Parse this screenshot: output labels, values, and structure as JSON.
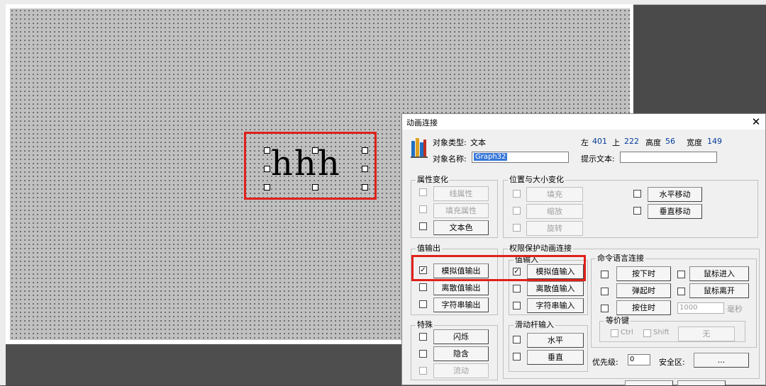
{
  "canvas": {
    "text_object": "hhh"
  },
  "dialog": {
    "title": "动画连接",
    "close": "✕",
    "object_type_label": "对象类型:",
    "object_type": "文本",
    "object_name_label": "对象名称:",
    "object_name": "Graph32",
    "left_label": "左",
    "left": "401",
    "top_label": "上",
    "top": "222",
    "height_label": "高度",
    "height": "56",
    "width_label": "宽度",
    "width": "149",
    "hint_label": "提示文本:",
    "hint": "",
    "attr_change": {
      "title": "属性变化",
      "line": "线属性",
      "fill": "填充属性",
      "text_color": "文本色"
    },
    "pos_size": {
      "title": "位置与大小变化",
      "fill": "填充",
      "scale": "缩放",
      "rotate": "旋转",
      "h_move": "水平移动",
      "v_move": "垂直移动"
    },
    "value_output": {
      "title": "值输出",
      "analog": "模拟值输出",
      "discrete": "离散值输出",
      "string": "字符串输出",
      "analog_checked": "✓"
    },
    "perm": {
      "title": "权限保护动画连接"
    },
    "value_input": {
      "title": "值输入",
      "analog": "模拟值输入",
      "discrete": "离散值输入",
      "string": "字符串输入",
      "analog_checked": "✓"
    },
    "command": {
      "title": "命令语言连接",
      "press": "按下时",
      "release": "弹起时",
      "hold": "按住时",
      "hold_ms": "1000",
      "ms": "毫秒",
      "mouse_enter": "鼠标进入",
      "mouse_leave": "鼠标离开"
    },
    "hotkey": {
      "title": "等价键",
      "ctrl": "Ctrl",
      "shift": "Shift",
      "none": "无"
    },
    "special": {
      "title": "特殊",
      "blink": "闪烁",
      "hide": "隐含",
      "flow": "流动"
    },
    "slider": {
      "title": "滑动杆输入",
      "horizontal": "水平",
      "vertical": "垂直"
    },
    "priority_label": "优先级:",
    "priority": "0",
    "security_label": "安全区:",
    "security_button": "..."
  }
}
